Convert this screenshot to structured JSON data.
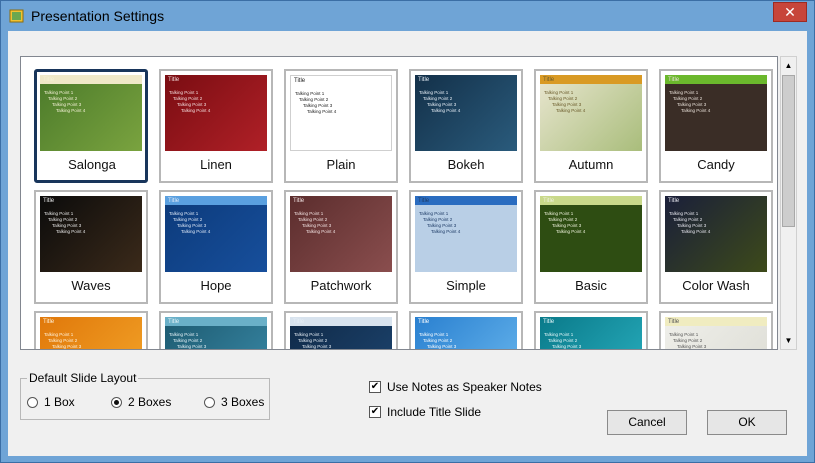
{
  "window": {
    "title": "Presentation Settings",
    "close_glyph": "✕"
  },
  "gallery": {
    "themes": [
      {
        "name": "Salonga",
        "selected": true,
        "bg": "#4b7a2a",
        "bg2": "#7aa33f",
        "band": "#efe8c8",
        "text": "#f4f1d6"
      },
      {
        "name": "Linen",
        "selected": false,
        "bg": "#7a0d12",
        "bg2": "#b02027",
        "band": "",
        "text": "#f3dede"
      },
      {
        "name": "Plain",
        "selected": false,
        "bg": "#ffffff",
        "bg2": "#ffffff",
        "band": "",
        "text": "#222222"
      },
      {
        "name": "Bokeh",
        "selected": false,
        "bg": "#133049",
        "bg2": "#2a5b7c",
        "band": "",
        "text": "#e8f0f8"
      },
      {
        "name": "Autumn",
        "selected": false,
        "bg": "#e9e6d0",
        "bg2": "#a9bd7b",
        "band": "#d99a24",
        "text": "#6a5a2a"
      },
      {
        "name": "Candy",
        "selected": false,
        "bg": "#3a2d26",
        "bg2": "#3a2d26",
        "band": "#6bb82c",
        "text": "#e8e0d8"
      },
      {
        "name": "Waves",
        "selected": false,
        "bg": "#0b0b0b",
        "bg2": "#3b2a1a",
        "band": "",
        "text": "#e8e8e8"
      },
      {
        "name": "Hope",
        "selected": false,
        "bg": "#0c3a7a",
        "bg2": "#174f9c",
        "band": "#5aa0e0",
        "text": "#dfe9f7"
      },
      {
        "name": "Patchwork",
        "selected": false,
        "bg": "#5b2d2d",
        "bg2": "#8a4e4e",
        "band": "",
        "text": "#f2e3e3"
      },
      {
        "name": "Simple",
        "selected": false,
        "bg": "#b9cfe6",
        "bg2": "#b9cfe6",
        "band": "#2a6cc0",
        "text": "#1e3b66"
      },
      {
        "name": "Basic",
        "selected": false,
        "bg": "#2e4d12",
        "bg2": "#2e4d12",
        "band": "#c9d98a",
        "text": "#eef2dc"
      },
      {
        "name": "Color Wash",
        "selected": false,
        "bg": "#1a1f3a",
        "bg2": "#3d4a1a",
        "band": "",
        "text": "#e8e8f0"
      },
      {
        "name": "",
        "selected": false,
        "bg": "#e0780a",
        "bg2": "#f3a52a",
        "band": "",
        "text": "#fff3dc"
      },
      {
        "name": "",
        "selected": false,
        "bg": "#1d5a70",
        "bg2": "#3a8aa8",
        "band": "#6ab0c8",
        "text": "#e6f3f8"
      },
      {
        "name": "",
        "selected": false,
        "bg": "#102a48",
        "bg2": "#1d4570",
        "band": "#d8e3ee",
        "text": "#e6eef6"
      },
      {
        "name": "",
        "selected": false,
        "bg": "#2a80d0",
        "bg2": "#6ab8ee",
        "band": "",
        "text": "#ffffff"
      },
      {
        "name": "",
        "selected": false,
        "bg": "#0a7a8a",
        "bg2": "#2ab0c0",
        "band": "",
        "text": "#e6f8fa"
      },
      {
        "name": "",
        "selected": false,
        "bg": "#efefea",
        "bg2": "#dcdcd4",
        "band": "#f0ecc0",
        "text": "#555555"
      }
    ],
    "thumb_title": "Title",
    "thumb_points": [
      "Talking Point 1",
      "Talking Point 2",
      "Talking Point 3",
      "Talking Point 4"
    ]
  },
  "layout_group": {
    "legend": "Default Slide Layout",
    "options": [
      {
        "label": "1 Box",
        "checked": false
      },
      {
        "label": "2 Boxes",
        "checked": true
      },
      {
        "label": "3 Boxes",
        "checked": false
      }
    ]
  },
  "options": {
    "speaker_notes": {
      "label": "Use Notes as Speaker Notes",
      "checked": true
    },
    "title_slide": {
      "label": "Include Title Slide",
      "checked": true
    }
  },
  "buttons": {
    "cancel": "Cancel",
    "ok": "OK"
  },
  "colors": {
    "titlebar": "#6fa4d6",
    "close": "#c7453a",
    "selection": "#18355b"
  }
}
